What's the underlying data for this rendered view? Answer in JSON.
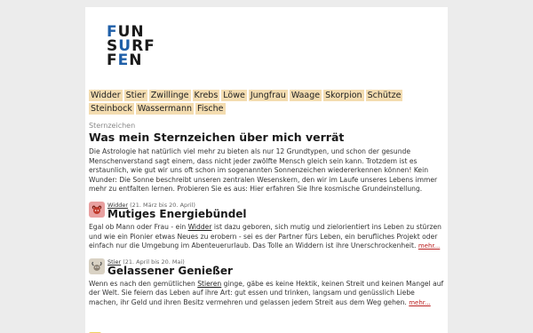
{
  "logo": {
    "line1": "FUN",
    "line2": "SURF",
    "line3": "EN"
  },
  "nav": {
    "signs": [
      "Widder",
      "Stier",
      "Zwillinge",
      "Krebs",
      "Löwe",
      "Jungfrau",
      "Waage",
      "Skorpion",
      "Schütze",
      "Steinbock",
      "Wassermann",
      "Fische"
    ]
  },
  "article": {
    "kicker": "Sternzeichen",
    "title": "Was mein Sternzeichen über mich verrät",
    "intro": "Die Astrologie hat natürlich viel mehr zu bieten als nur 12 Grundtypen, und schon der gesunde Menschenverstand sagt einem, dass nicht jeder zwölfte Mensch gleich sein kann. Trotzdem ist es erstaunlich, wie gut wir uns oft schon im sogenannten Sonnenzeichen wiedererkennen können! Kein Wunder: Die Sonne beschreibt unseren zentralen Wesenskern, den wir im Laufe unseres Lebens immer mehr zu entfalten lernen. Probieren Sie es aus: Hier erfahren Sie Ihre kosmische Grundeinstellung."
  },
  "entries": [
    {
      "sign": "Widder",
      "dates": "(21. März bis 20. April)",
      "title": "Mutiges Energiebündel",
      "text_before": "Egal ob Mann oder Frau - ein ",
      "link": "Widder",
      "text_after": " ist dazu geboren, sich mutig und zielorientiert ins Leben zu stürzen und wie ein Pionier etwas Neues zu erobern - sei es der Partner fürs Leben, ein berufliches Projekt oder einfach nur die Umgebung im Abenteuerurlaub. Das Tolle an Widdern ist ihre Unerschrockenheit. ",
      "more": "mehr..."
    },
    {
      "sign": "Stier",
      "dates": "(21. April bis 20. Mai)",
      "title": "Gelassener Genießer",
      "text_before": "Wenn es nach den gemütlichen ",
      "link": "Stieren",
      "text_after": " ginge, gäbe es keine Hektik, keinen Streit und keinen Mangel auf der Welt. Sie feiern das Leben auf ihre Art: gut essen und trinken, langsam und genüsslich Liebe machen, ihr Geld und ihren Besitz vermehren und gelassen jedem Streit aus dem Weg gehen. ",
      "more": "mehr..."
    }
  ],
  "colors": {
    "logo_blue": "#1f5fa8",
    "nav_bg": "#f3dcb0",
    "more_link": "#bb2222"
  }
}
